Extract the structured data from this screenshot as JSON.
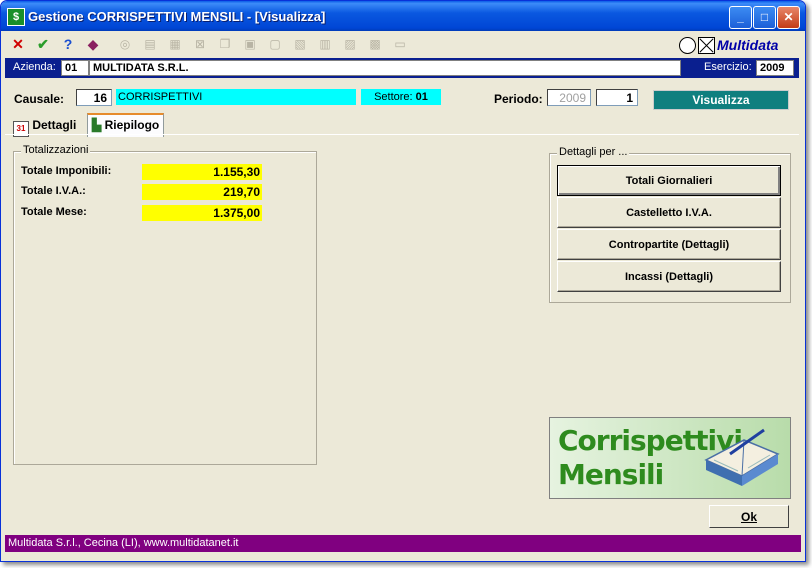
{
  "window": {
    "title": "Gestione CORRISPETTIVI MENSILI - [Visualizza]",
    "minimize": "_",
    "maximize": "□",
    "close": "✕"
  },
  "toolbar": {
    "brand": "Multidata"
  },
  "header": {
    "azienda_label": "Azienda:",
    "azienda_code": "01",
    "azienda_name": "MULTIDATA S.R.L.",
    "esercizio_label": "Esercizio:",
    "esercizio_value": "2009"
  },
  "form": {
    "causale_label": "Causale:",
    "causale_code": "16",
    "causale_desc": "CORRISPETTIVI",
    "settore_label": "Settore:",
    "settore_value": "01",
    "periodo_label": "Periodo:",
    "periodo_year": "2009",
    "periodo_month": "1",
    "visualizza_label": "Visualizza"
  },
  "tabs": [
    {
      "label": "Dettagli"
    },
    {
      "label": "Riepilogo"
    }
  ],
  "totalizzazioni": {
    "title": "Totalizzazioni",
    "rows": [
      {
        "label": "Totale Imponibili:",
        "value": "1.155,30"
      },
      {
        "label": "Totale I.V.A.:",
        "value": "219,70"
      },
      {
        "label": "Totale Mese:",
        "value": "1.375,00"
      }
    ]
  },
  "dettagli": {
    "title": "Dettagli per ...",
    "buttons": [
      {
        "label": "Totali Giornalieri"
      },
      {
        "label": "Castelletto I.V.A."
      },
      {
        "label": "Contropartite (Dettagli)"
      },
      {
        "label": "Incassi (Dettagli)"
      }
    ]
  },
  "banner": {
    "line1": "Corrispettivi",
    "line2": "Mensili"
  },
  "ok_label": "Ok",
  "status_text": "Multidata S.r.l., Cecina (LI), www.multidatanet.it"
}
